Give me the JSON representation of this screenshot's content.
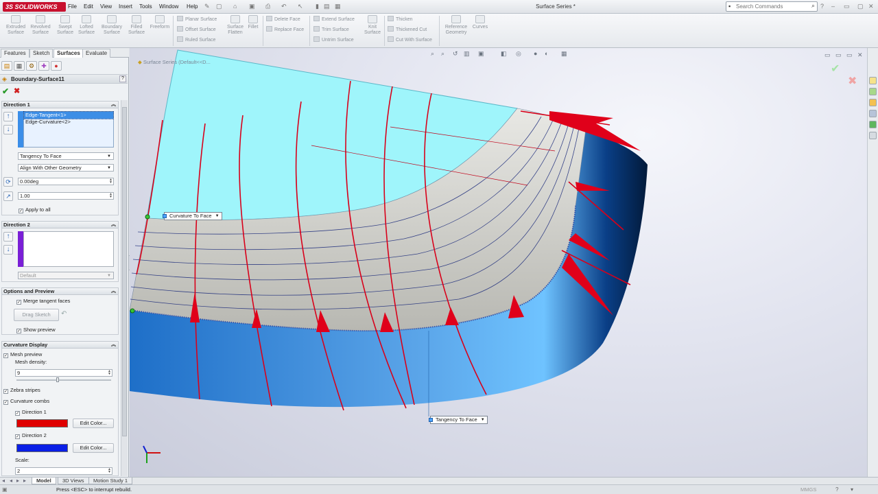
{
  "app": {
    "logo_text": "3S SOLIDWORKS",
    "window_title": "Surface Series *",
    "menu": [
      "File",
      "Edit",
      "View",
      "Insert",
      "Tools",
      "Window",
      "Help"
    ],
    "search_placeholder": "Search Commands"
  },
  "ribbon": {
    "big_buttons": [
      {
        "label": "Extruded\nSurface"
      },
      {
        "label": "Revolved\nSurface"
      },
      {
        "label": "Swept\nSurface"
      },
      {
        "label": "Lofted\nSurface"
      },
      {
        "label": "Boundary\nSurface"
      },
      {
        "label": "Filled\nSurface"
      },
      {
        "label": "Freeform"
      }
    ],
    "group1": [
      "Planar Surface",
      "Offset Surface",
      "Ruled Surface"
    ],
    "radiate": "Surface\nFlatten",
    "fillet": "Fillet",
    "group2": [
      "Delete Face",
      "Replace Face"
    ],
    "group3": [
      "Extend Surface",
      "Trim Surface",
      "Untrim Surface"
    ],
    "knit": "Knit\nSurface",
    "group4": [
      "Thicken",
      "Thickened Cut",
      "Cut With Surface"
    ],
    "refgeom": "Reference\nGeometry",
    "curves": "Curves"
  },
  "feature_tabs": [
    "Features",
    "Sketch",
    "Surfaces",
    "Evaluate"
  ],
  "active_feature_tab": "Surfaces",
  "property_manager": {
    "title": "Boundary-Surface11",
    "direction1": {
      "header": "Direction 1",
      "items": [
        "Edge-Tangent<1>",
        "Edge-Curvature<2>"
      ],
      "tangency": "Tangency To Face",
      "alignment": "Align With Other Geometry",
      "angle": "0.00deg",
      "influence": "1.00",
      "apply_all": "Apply to all"
    },
    "direction2": {
      "header": "Direction 2",
      "alignment": "Default",
      "color": "#7a1fd6"
    },
    "options": {
      "header": "Options and Preview",
      "merge": "Merge tangent faces",
      "drag_sketch": "Drag Sketch",
      "show_preview": "Show preview"
    },
    "curvature": {
      "header": "Curvature Display",
      "mesh_preview": "Mesh preview",
      "mesh_density_label": "Mesh density:",
      "mesh_density": "9",
      "zebra": "Zebra stripes",
      "combs": "Curvature combs",
      "dir1": "Direction 1",
      "dir1_color": "#e00000",
      "dir2": "Direction 2",
      "dir2_color": "#0a1fe6",
      "edit_color": "Edit Color...",
      "scale_label": "Scale:",
      "scale": "2"
    }
  },
  "viewport": {
    "tree_label": "Surface Series  (Default<<D...",
    "callout_top": "Curvature To Face",
    "callout_bottom": "Tangency To Face",
    "triad_labels": [
      "X",
      "Y"
    ]
  },
  "bottom_tabs": [
    "Model",
    "3D Views",
    "Motion Study 1"
  ],
  "active_bottom_tab": "Model",
  "status": {
    "message": "Press <ESC> to interrupt rebuild.",
    "units": "MMGS"
  }
}
